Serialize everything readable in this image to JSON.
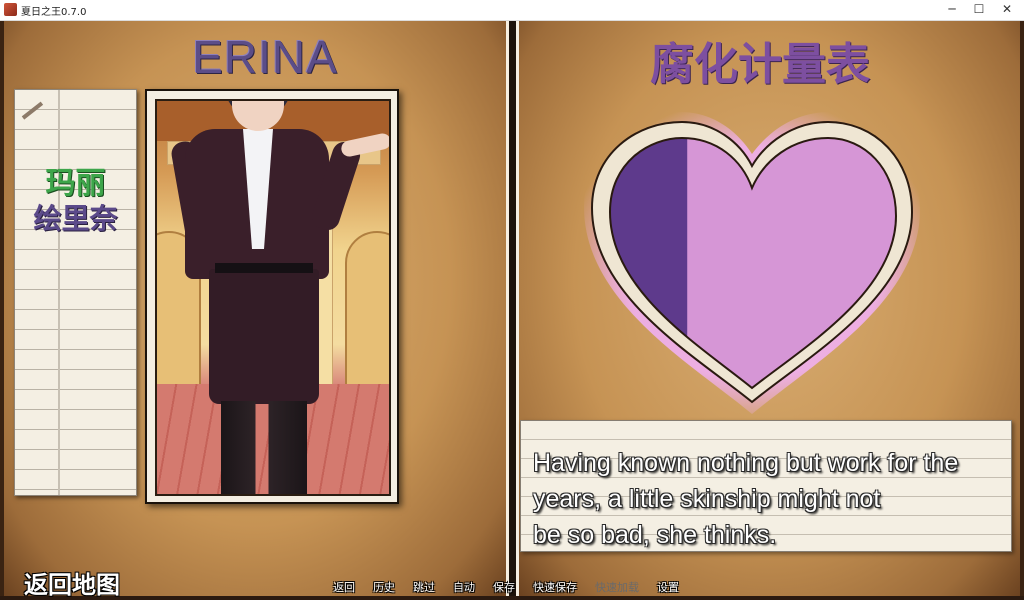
{
  "window": {
    "title": "夏日之王0.7.0",
    "minimize": "─",
    "maximize": "☐",
    "close": "✕"
  },
  "left_page": {
    "character_title": "ERINA",
    "names": [
      "玛丽",
      "绘里奈"
    ]
  },
  "right_page": {
    "meter_title": "腐化计量表",
    "corruption_fill": 0.27,
    "dialogue": [
      "Having known nothing but work for the",
      "years, a little skinship might not",
      "be so bad, she thinks."
    ]
  },
  "bottom": {
    "return_map": "返回地图",
    "quick_menu": [
      {
        "label": "返回",
        "enabled": true
      },
      {
        "label": "历史",
        "enabled": true
      },
      {
        "label": "跳过",
        "enabled": true
      },
      {
        "label": "自动",
        "enabled": true
      },
      {
        "label": "保存",
        "enabled": true
      },
      {
        "label": "快速保存",
        "enabled": true
      },
      {
        "label": "快速加载",
        "enabled": false
      },
      {
        "label": "设置",
        "enabled": true
      }
    ]
  },
  "colors": {
    "title_left": "#5b4d88",
    "title_right": "#7d4fa0",
    "heart_fill_dark": "#5e3a8c",
    "heart_fill_light": "#d696d6",
    "name_active": "#3da54a",
    "name_inactive": "#5b4a8a"
  }
}
